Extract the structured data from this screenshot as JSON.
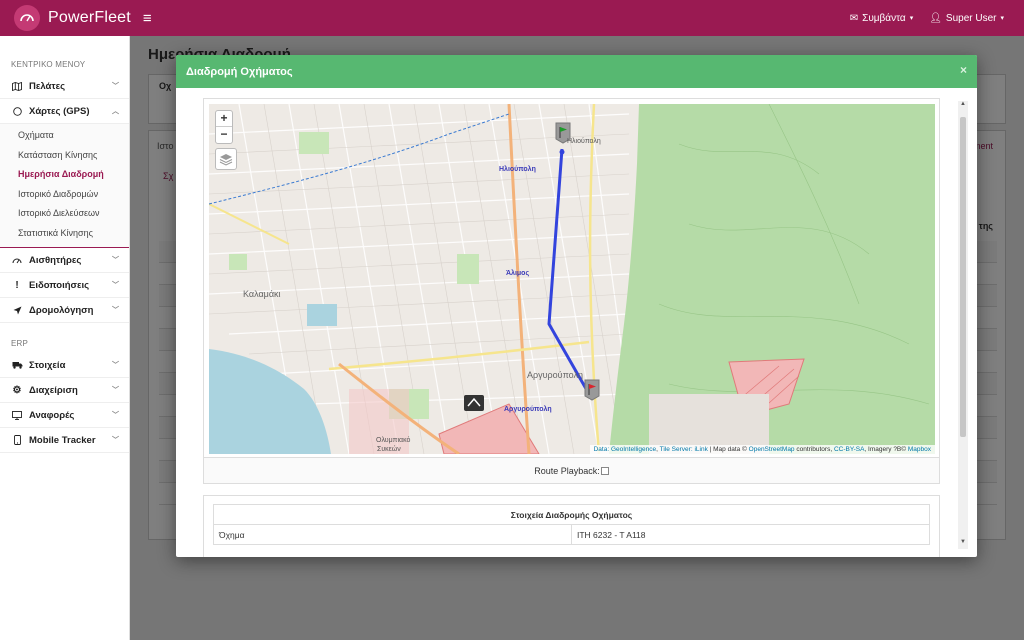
{
  "app": {
    "brand": "PowerFleet"
  },
  "topbar": {
    "messages_label": "Συμβάντα",
    "user_label": "Super User"
  },
  "sidebar": {
    "section_main": "ΚΕΝΤΡΙΚΟ ΜΕΝΟΥ",
    "section_erp": "ERP",
    "items": [
      {
        "label": "Πελάτες",
        "icon": "map-icon"
      },
      {
        "label": "Χάρτες (GPS)",
        "icon": "circle-icon"
      },
      {
        "label": "Αισθητήρες",
        "icon": "gauge-icon"
      },
      {
        "label": "Ειδοποιήσεις",
        "icon": "exclamation-icon"
      },
      {
        "label": "Δρομολόγηση",
        "icon": "location-arrow-icon"
      }
    ],
    "sub_items": [
      "Οχήματα",
      "Κατάσταση Κίνησης",
      "Ημερήσια Διαδρομή",
      "Ιστορικό Διαδρομών",
      "Ιστορικό Διελεύσεων",
      "Στατιστικά Κίνησης"
    ],
    "active_sub": "Ημερήσια Διαδρομή",
    "erp_items": [
      {
        "label": "Στοιχεία",
        "icon": "truck-icon"
      },
      {
        "label": "Διαχείριση",
        "icon": "gear-icon"
      },
      {
        "label": "Αναφορές",
        "icon": "monitor-icon"
      },
      {
        "label": "Mobile Tracker",
        "icon": "mobile-icon"
      }
    ]
  },
  "background": {
    "page_title": "Ημερήσια Διαδρομή",
    "panel_label": "Οχ",
    "tab_left": "Ιστο",
    "tab_right": "ment",
    "sub_tab": "Σχ",
    "col_label": "της"
  },
  "modal": {
    "title": "Διαδρομή Οχήματος",
    "close_label": "×",
    "playback_label": "Route Playback:",
    "info_title": "Στοιχεία Διαδρομής Οχήματος",
    "info_rows": [
      {
        "label": "Όχημα",
        "value": "ΙΤΗ 6232 - Τ Α118"
      }
    ]
  },
  "map": {
    "zoom_in": "+",
    "zoom_out": "−",
    "attribution": {
      "prefix": "Data:",
      "geo": "GeoIntelligence",
      "tile": "Tile Server:",
      "ilink": "iLink",
      "mapdata": "| Map data ©",
      "osm": "OpenStreetMap",
      "contrib": "contributors,",
      "license": "CC-BY-SA",
      "imagery": ", Imagery ?B©",
      "mapbox": "Mapbox"
    },
    "places": {
      "ilioupoli": "Ηλιούπολη",
      "ilioupoli2": "Ηλιούπολη",
      "alimos": "Άλιμος",
      "argyroupoli": "Αργυρούπολη",
      "argyroupoli2": "Αργυρούπολη",
      "kalamaki": "Καλαμάκι",
      "olympic": "Ολυμπιακό",
      "sykon": "Συκεών"
    },
    "colors": {
      "route": "#3344dd",
      "park": "#a8d5a0",
      "water": "#aad3df",
      "land": "#eeeae5"
    }
  }
}
